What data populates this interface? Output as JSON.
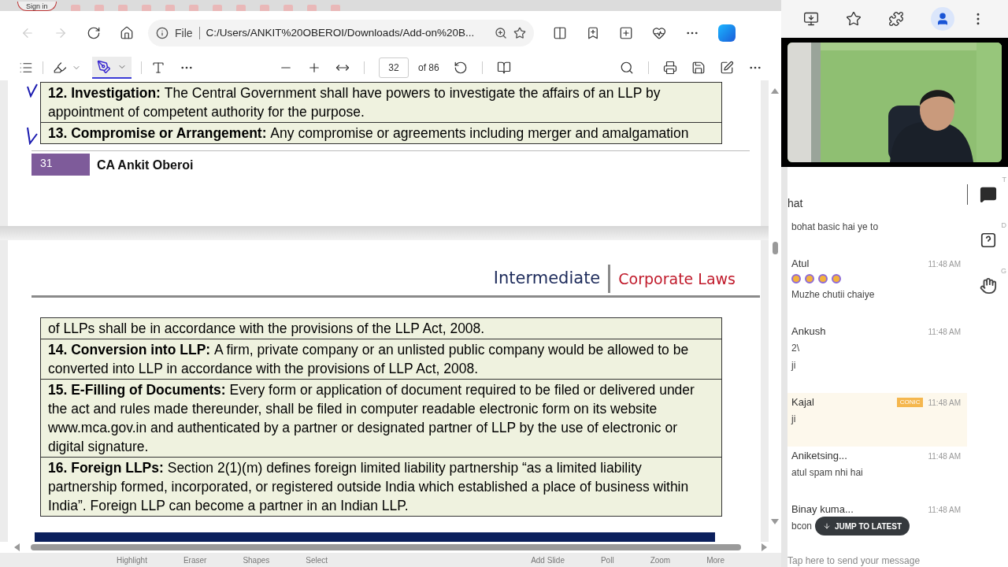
{
  "browser": {
    "sign_in": "Sign in",
    "address": {
      "scheme": "File",
      "url": "C:/Users/ANKIT%20OBEROI/Downloads/Add-on%20B..."
    }
  },
  "pdf_toolbar": {
    "page": "32",
    "page_count": "of 86"
  },
  "document": {
    "page_top": {
      "rows": [
        {
          "heading": "12. Investigation:",
          "text": "The Central Government shall have powers to investigate the affairs of an LLP by appointment of competent authority for the purpose."
        },
        {
          "heading": "13. Compromise or Arrangement:",
          "text": "Any compromise or agreements including merger and amalgamation"
        }
      ],
      "footer": {
        "page_number": "31",
        "author": "CA Ankit Oberoi"
      }
    },
    "page_next": {
      "header": {
        "course": "Intermediate",
        "subject": "Corporate Laws"
      },
      "rows": [
        {
          "text": "of LLPs shall be in accordance with the provisions of the LLP Act, 2008."
        },
        {
          "heading": "14. Conversion into LLP:",
          "text": "A firm, private company or an unlisted public company would be allowed to be converted into LLP in accordance with the provisions of LLP Act, 2008."
        },
        {
          "heading": "15. E-Filling of Documents:",
          "text": "Every form or application of document required to be filed or delivered under the act and rules made thereunder, shall be filed in computer readable electronic form on its website www.mca.gov.in and authenticated by a partner or designated partner of LLP by the use of electronic or digital signature."
        },
        {
          "heading": "16. Foreign LLPs:",
          "text": "Section 2(1)(m) defines foreign limited liability partnership “as a limited liability partnership formed, incorporated, or registered outside India which established a place of business within India”. Foreign LLP can become a partner in an Indian LLP."
        }
      ]
    }
  },
  "whiteboard_tools": {
    "left": [
      "Highlight",
      "Eraser",
      "Shapes",
      "Select"
    ],
    "right": [
      "Add Slide",
      "Poll",
      "Zoom",
      "More"
    ]
  },
  "chat": {
    "title": "hat",
    "messages": [
      {
        "lines": [
          {
            "kind": "text",
            "text": "bohat basic hai ye to"
          }
        ],
        "highlighted": false
      },
      {
        "name": "Atul",
        "time": "11:48 AM",
        "lines": [
          {
            "kind": "emojis",
            "emojis": [
              {
                "kind": "emoji"
              },
              {
                "kind": "emoji"
              },
              {
                "kind": "emoji"
              },
              {
                "kind": "emoji"
              }
            ]
          },
          {
            "kind": "text",
            "text": "Muzhe chutii chaiye"
          }
        ],
        "highlighted": false
      },
      {
        "name": "Ankush",
        "time": "11:48 AM",
        "lines": [
          {
            "kind": "text",
            "text": "2\\"
          },
          {
            "kind": "text",
            "text": "ji"
          }
        ],
        "highlighted": false
      },
      {
        "name": "Kajal",
        "badge": "CONIC",
        "time": "11:48 AM",
        "lines": [
          {
            "kind": "text",
            "text": "ji"
          }
        ],
        "highlighted": true
      },
      {
        "name": "Aniketsing...",
        "time": "11:48 AM",
        "lines": [
          {
            "kind": "text",
            "text": "atul spam nhi hai"
          }
        ],
        "highlighted": false
      },
      {
        "name": "Binay kuma...",
        "time": "11:48 AM",
        "lines": [
          {
            "kind": "text",
            "text": "bcon"
          }
        ],
        "highlighted": false
      }
    ],
    "jump_button": "JUMP TO LATEST",
    "input": {
      "placeholder": "Tap here to send your message"
    }
  },
  "side_tabs": [
    {
      "letter": "T",
      "kind": "chat",
      "selected": true
    },
    {
      "letter": "D",
      "kind": "doubt",
      "selected": false
    },
    {
      "letter": "G",
      "kind": "raise-hand",
      "selected": false
    }
  ]
}
